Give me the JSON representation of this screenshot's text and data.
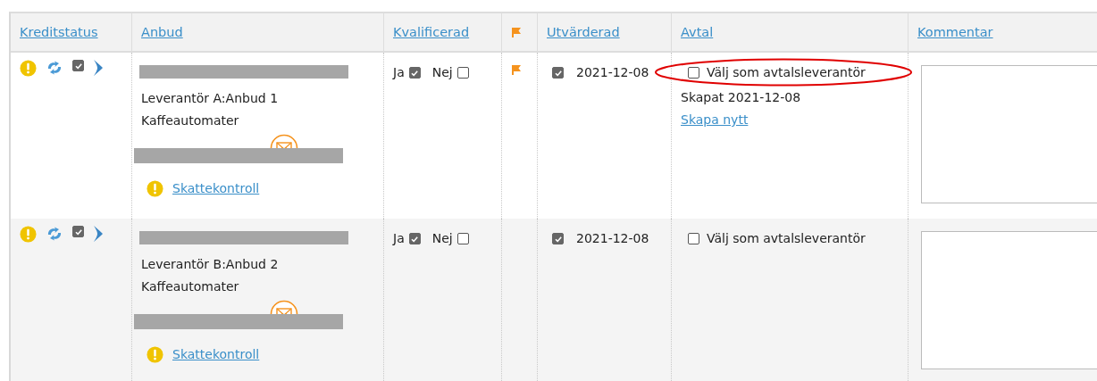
{
  "columns": [
    {
      "kind": "link",
      "label": "Kreditstatus"
    },
    {
      "kind": "link",
      "label": "Anbud"
    },
    {
      "kind": "link",
      "label": "Kvalificerad"
    },
    {
      "kind": "flag"
    },
    {
      "kind": "link",
      "label": "Utvärderad"
    },
    {
      "kind": "link",
      "label": "Avtal"
    },
    {
      "kind": "link",
      "label": "Kommentar"
    }
  ],
  "rows": [
    {
      "credit_checked": true,
      "bid": "Leverantör A:Anbud 1",
      "category": "Kaffeautomater",
      "tax_check": "Skattekontroll",
      "yes_label": "Ja",
      "qualified_yes": true,
      "no_label": "Nej",
      "qualified_no": false,
      "flagged": true,
      "evaluated": true,
      "evaluated_date": "2021-12-08",
      "contract_selected": false,
      "contract_label": "Välj som avtalsleverantör",
      "contract_created": "Skapat 2021-12-08",
      "contract_new": "Skapa nytt",
      "circled": true
    },
    {
      "credit_checked": true,
      "bid": "Leverantör B:Anbud 2",
      "category": "Kaffeautomater",
      "tax_check": "Skattekontroll",
      "yes_label": "Ja",
      "qualified_yes": true,
      "no_label": "Nej",
      "qualified_no": false,
      "flagged": false,
      "evaluated": true,
      "evaluated_date": "2021-12-08",
      "contract_selected": false,
      "contract_label": "Välj som avtalsleverantör",
      "circled": false
    }
  ]
}
